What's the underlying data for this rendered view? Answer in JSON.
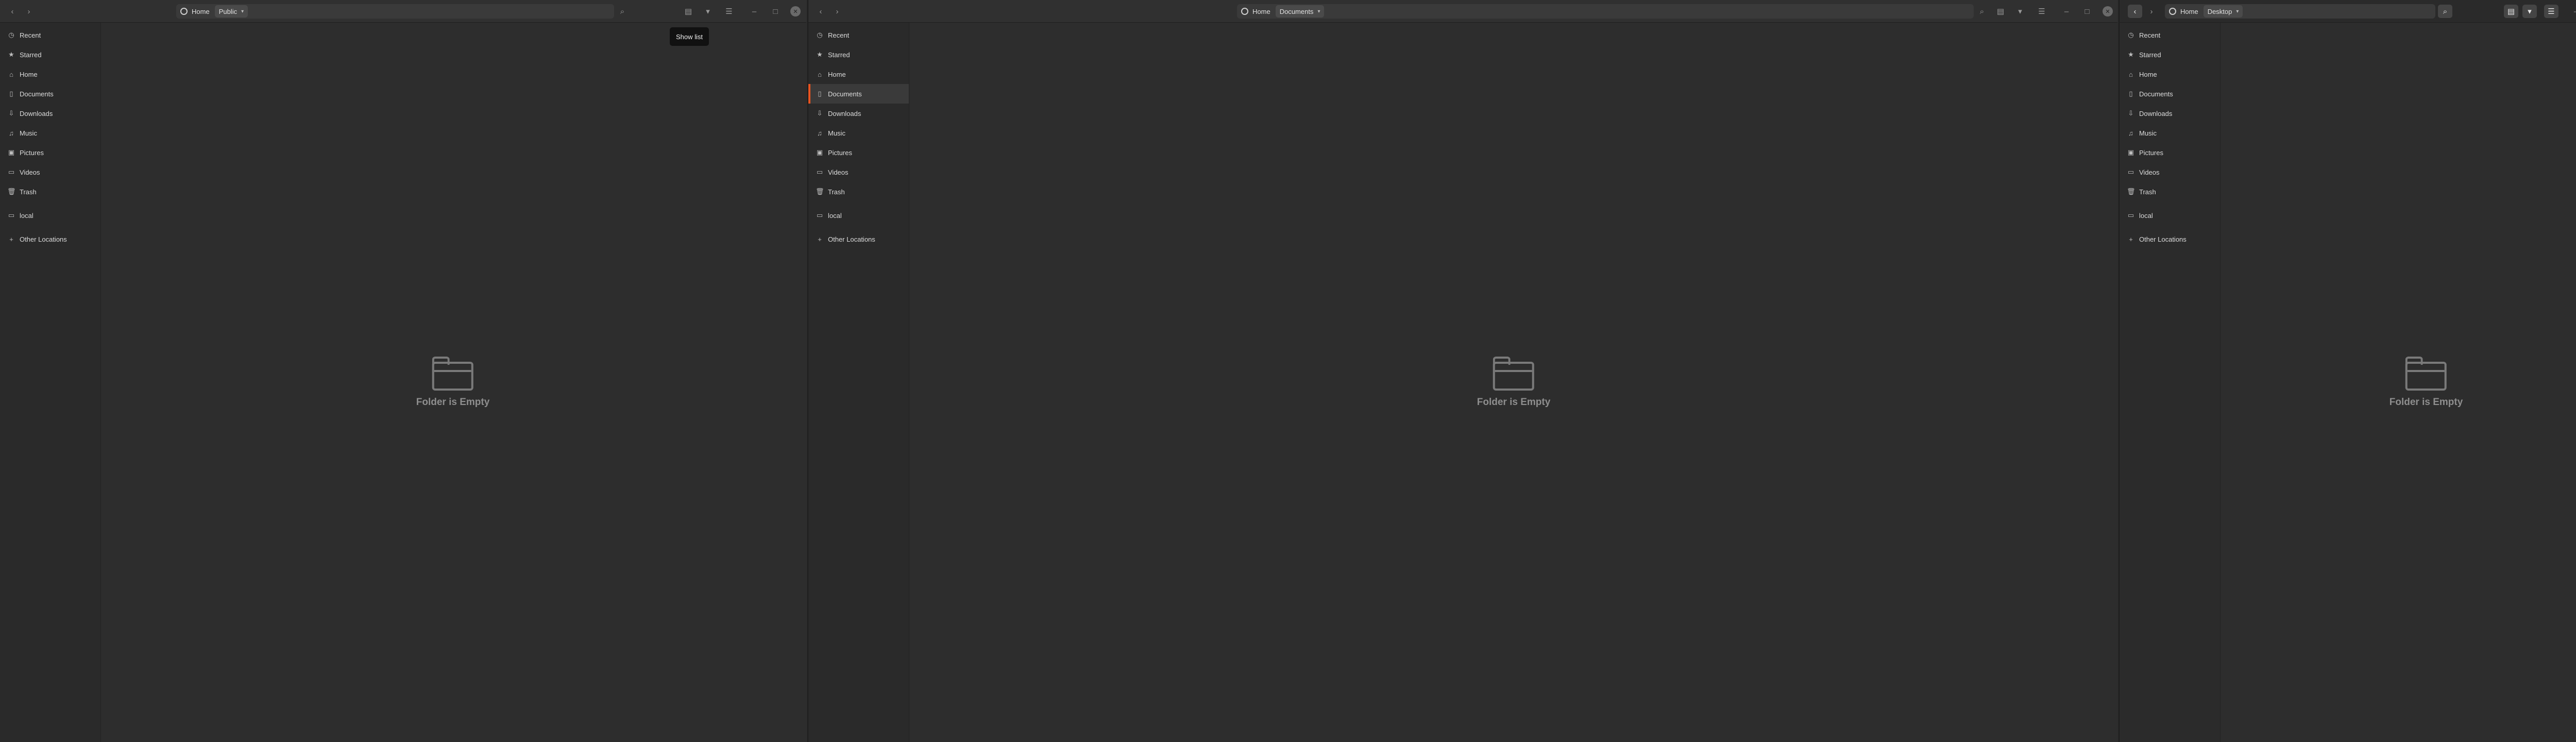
{
  "sidebar_items": [
    {
      "label": "Recent",
      "icon": "clock-icon"
    },
    {
      "label": "Starred",
      "icon": "star-icon"
    },
    {
      "label": "Home",
      "icon": "home-icon"
    },
    {
      "label": "Documents",
      "icon": "document-icon"
    },
    {
      "label": "Downloads",
      "icon": "download-icon"
    },
    {
      "label": "Music",
      "icon": "music-icon"
    },
    {
      "label": "Pictures",
      "icon": "picture-icon"
    },
    {
      "label": "Videos",
      "icon": "video-icon"
    },
    {
      "label": "Trash",
      "icon": "trash-icon"
    },
    {
      "label": "local",
      "icon": "drive-icon"
    },
    {
      "label": "Other Locations",
      "icon": "plus-icon"
    }
  ],
  "windows": [
    {
      "path": {
        "home": "Home",
        "current": "Public"
      },
      "selected_sidebar": null,
      "empty_text": "Folder is Empty",
      "tooltip": "Show list"
    },
    {
      "path": {
        "home": "Home",
        "current": "Documents"
      },
      "selected_sidebar": "Documents",
      "empty_text": "Folder is Empty"
    },
    {
      "path": {
        "home": "Home",
        "current": "Desktop"
      },
      "selected_sidebar": null,
      "empty_text": "Folder is Empty"
    }
  ],
  "icons": {
    "back": "‹",
    "forward": "›",
    "search": "⌕",
    "view_grid": "▤",
    "view_menu": "▾",
    "menu": "☰",
    "minimize": "–",
    "maximize": "□",
    "close": "✕"
  },
  "colors": {
    "accent": "#e95420",
    "window_bg": "#2d2d2d",
    "sidebar_bg": "#2a2a2a",
    "desktop": "#5a1a4c"
  }
}
